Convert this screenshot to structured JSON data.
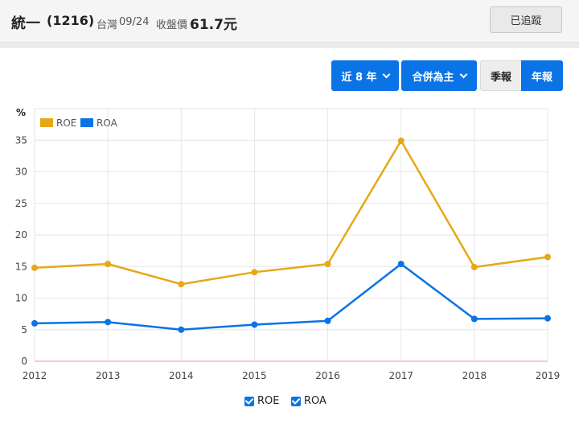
{
  "header": {
    "name": "統一",
    "code": "(1216)",
    "market": "台灣",
    "date": "09/24",
    "price_label": "收盤價",
    "price": "61.7元",
    "follow_label": "已追蹤"
  },
  "controls": {
    "period_label": "近 8 年",
    "consolidation_label": "合併為主",
    "quarterly_label": "季報",
    "annual_label": "年報"
  },
  "chart_data": {
    "type": "line",
    "ylabel": "%",
    "ylim": [
      0,
      40
    ],
    "yticks": [
      "0",
      "5",
      "10",
      "15",
      "20",
      "25",
      "30",
      "35"
    ],
    "categories": [
      "2012",
      "2013",
      "2014",
      "2015",
      "2016",
      "2017",
      "2018",
      "2019"
    ],
    "series": [
      {
        "name": "ROE",
        "color": "#e6a817",
        "values": [
          14.8,
          15.4,
          12.2,
          14.1,
          15.4,
          34.9,
          14.9,
          16.5
        ]
      },
      {
        "name": "ROA",
        "color": "#0a73e6",
        "values": [
          6.0,
          6.2,
          5.0,
          5.8,
          6.4,
          15.4,
          6.7,
          6.8
        ]
      }
    ],
    "legend": "top-left",
    "grid": true
  },
  "toggles": {
    "roe_label": "ROE",
    "roa_label": "ROA"
  }
}
